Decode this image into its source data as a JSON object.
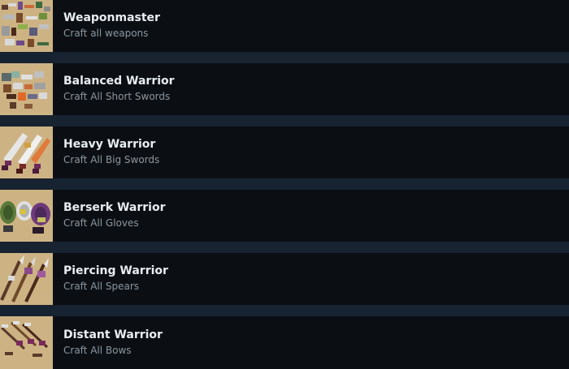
{
  "achievements": [
    {
      "title": "Weaponmaster",
      "description": "Craft all weapons",
      "icon": "weapons-icon"
    },
    {
      "title": "Balanced Warrior",
      "description": "Craft All Short Swords",
      "icon": "short-swords-icon"
    },
    {
      "title": "Heavy Warrior",
      "description": "Craft All Big Swords",
      "icon": "big-swords-icon"
    },
    {
      "title": "Berserk Warrior",
      "description": "Craft All Gloves",
      "icon": "gloves-icon"
    },
    {
      "title": "Piercing Warrior",
      "description": "Craft All Spears",
      "icon": "spears-icon"
    },
    {
      "title": "Distant Warrior",
      "description": "Craft All Bows",
      "icon": "bows-icon"
    }
  ],
  "colors": {
    "background": "#182331",
    "row": "#0b0f14",
    "icon_bg": "#cdb384",
    "title": "#e8edf2",
    "description": "#8c96a0"
  }
}
